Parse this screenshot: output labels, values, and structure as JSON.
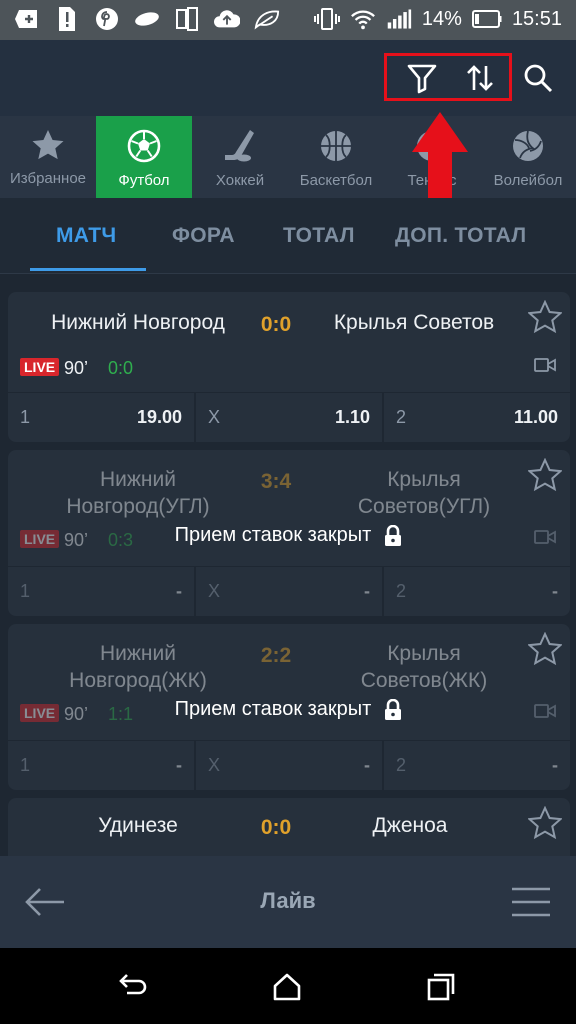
{
  "status_bar": {
    "battery_pct": "14%",
    "time": "15:51",
    "icons": [
      "plus-message-icon",
      "sim-alert-icon",
      "pinterest-icon",
      "cloud-icon",
      "sim-card-icon",
      "cloud-upload-icon",
      "leaf-icon",
      "vibrate-icon",
      "wifi-icon",
      "signal-icon",
      "battery-icon"
    ]
  },
  "header": {
    "icons": [
      "filter-icon",
      "sort-icon",
      "search-icon"
    ]
  },
  "sports": [
    {
      "label": "Избранное",
      "icon": "star-icon",
      "active": false
    },
    {
      "label": "Футбол",
      "icon": "soccer-ball-icon",
      "active": true
    },
    {
      "label": "Хоккей",
      "icon": "hockey-icon",
      "active": false
    },
    {
      "label": "Баскетбол",
      "icon": "basketball-icon",
      "active": false
    },
    {
      "label": "Теннис",
      "icon": "tennis-icon",
      "active": false
    },
    {
      "label": "Волейбол",
      "icon": "volleyball-icon",
      "active": false
    }
  ],
  "bet_tabs": [
    {
      "label": "МАТЧ",
      "active": true
    },
    {
      "label": "ФОРА",
      "active": false
    },
    {
      "label": "ТОТАЛ",
      "active": false
    },
    {
      "label": "ДОП. ТОТАЛ",
      "active": false
    }
  ],
  "events": [
    {
      "home": "Нижний Новгород",
      "away": "Крылья Советов",
      "score": "0:0",
      "live": "LIVE",
      "minute": "90’",
      "current_score": "0:0",
      "closed": false,
      "odds": [
        {
          "label": "1",
          "value": "19.00"
        },
        {
          "label": "X",
          "value": "1.10"
        },
        {
          "label": "2",
          "value": "11.00"
        }
      ]
    },
    {
      "home_line1": "Нижний",
      "home_line2": "Новгород(УГЛ)",
      "away_line1": "Крылья",
      "away_line2": "Советов(УГЛ)",
      "score": "3:4",
      "live": "LIVE",
      "minute": "90’",
      "current_score": "0:3",
      "closed": true,
      "closed_text": "Прием ставок закрыт",
      "odds": [
        {
          "label": "1",
          "value": "-"
        },
        {
          "label": "X",
          "value": "-"
        },
        {
          "label": "2",
          "value": "-"
        }
      ]
    },
    {
      "home_line1": "Нижний",
      "home_line2": "Новгород(ЖК)",
      "away_line1": "Крылья",
      "away_line2": "Советов(ЖК)",
      "score": "2:2",
      "live": "LIVE",
      "minute": "90’",
      "current_score": "1:1",
      "closed": true,
      "closed_text": "Прием ставок закрыт",
      "odds": [
        {
          "label": "1",
          "value": "-"
        },
        {
          "label": "X",
          "value": "-"
        },
        {
          "label": "2",
          "value": "-"
        }
      ]
    },
    {
      "home": "Удинезе",
      "away": "Дженоа",
      "score": "0:0"
    }
  ],
  "bottom_bar": {
    "title": "Лайв",
    "icons": [
      "back-arrow-icon",
      "menu-icon"
    ]
  },
  "nav_bar": {
    "icons": [
      "back-icon",
      "home-icon",
      "recents-icon"
    ]
  },
  "colors": {
    "accent": "#3e9be8",
    "active_sport": "#1aa04a",
    "score": "#e0a12b",
    "live": "#d8262c",
    "highlight": "#e6101a"
  }
}
